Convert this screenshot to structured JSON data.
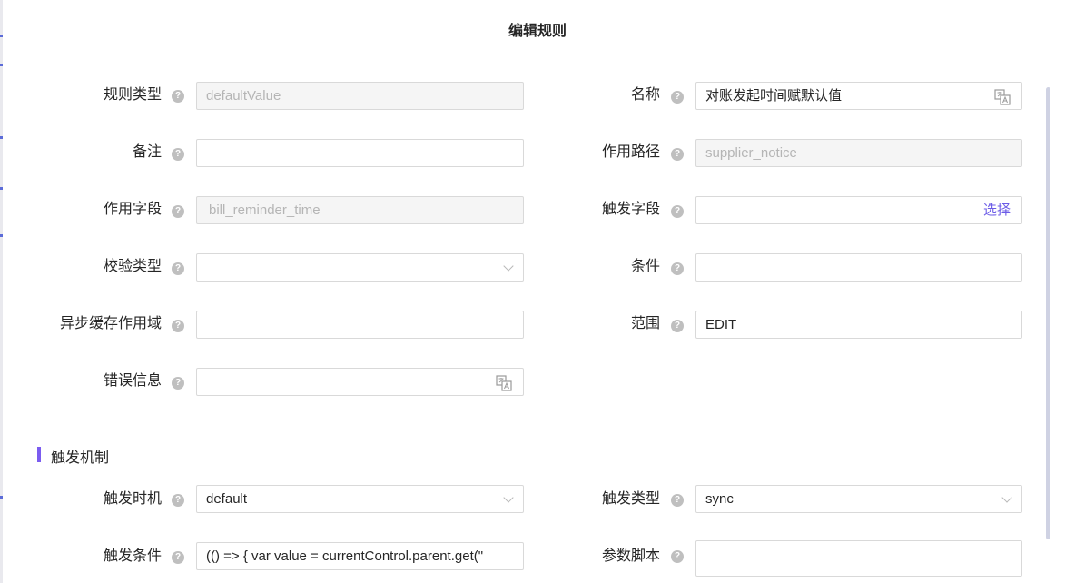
{
  "dialog": {
    "title": "编辑规则"
  },
  "help_glyph": "?",
  "fields": {
    "rule_type": {
      "label": "规则类型",
      "value": "defaultValue"
    },
    "name": {
      "label": "名称",
      "value": "对账发起时间赋默认值"
    },
    "remark": {
      "label": "备注",
      "value": ""
    },
    "path": {
      "label": "作用路径",
      "value": "supplier_notice"
    },
    "field": {
      "label": "作用字段",
      "value": "bill_reminder_time"
    },
    "trigger_field": {
      "label": "触发字段",
      "value": "",
      "action": "选择"
    },
    "validate_type": {
      "label": "校验类型",
      "value": ""
    },
    "condition": {
      "label": "条件",
      "value": ""
    },
    "async_cache_scope": {
      "label": "异步缓存作用域",
      "value": ""
    },
    "scope": {
      "label": "范围",
      "value": "EDIT"
    },
    "error_message": {
      "label": "错误信息",
      "value": ""
    }
  },
  "trigger_section": {
    "title": "触发机制",
    "timing": {
      "label": "触发时机",
      "value": "default"
    },
    "type": {
      "label": "触发类型",
      "value": "sync"
    },
    "condition": {
      "label": "触发条件",
      "value": "(() => {     var value = currentControl.parent.get(\""
    },
    "param_script": {
      "label": "参数脚本",
      "value": ""
    }
  },
  "colors": {
    "accent": "#7b5cf0",
    "link": "#6c5ce7",
    "border": "#d9d9d9",
    "disabled_bg": "#f5f5f5"
  }
}
